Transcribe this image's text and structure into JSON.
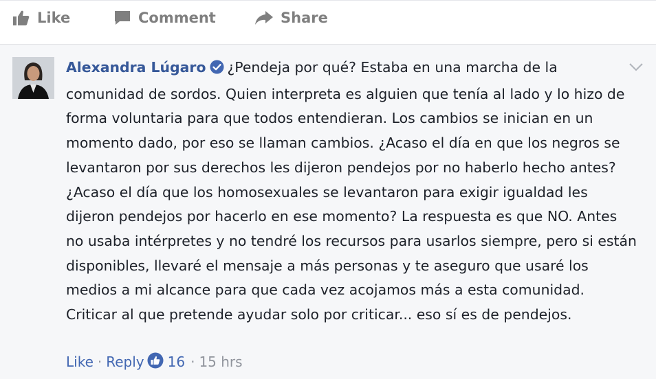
{
  "actions": {
    "like_label": "Like",
    "comment_label": "Comment",
    "share_label": "Share"
  },
  "comment": {
    "author": "Alexandra Lúgaro",
    "text": "¿Pendeja por qué? Estaba en una marcha de la comunidad de sordos. Quien interpreta es alguien que tenía al lado y lo hizo de forma voluntaria para que todos entendieran. Los cambios se inician en un momento dado, por eso se llaman cambios. ¿Acaso el día en que los negros se levantaron por sus derechos les dijeron pendejos por no haberlo hecho antes? ¿Acaso el día que los homosexuales se levantaron para exigir igualdad les dijeron pendejos por hacerlo en ese momento? La respuesta es que NO. Antes no usaba intérpretes y no tendré los recursos para usarlos siempre, pero si están disponibles, llevaré el mensaje a más personas y te aseguro que usaré los medios a mi alcance para que cada vez acojamos más a esta comunidad. Criticar al que pretende ayudar solo por criticar... eso sí es de pendejos.",
    "like_label": "Like",
    "reply_label": "Reply",
    "separator": "·",
    "reaction_count": "16",
    "timestamp": "15 hrs"
  },
  "icons": {
    "like": "thumbs-up-icon",
    "comment": "speech-bubble-icon",
    "share": "share-arrow-icon",
    "verified": "verified-badge-icon",
    "menu": "chevron-down-icon",
    "reaction": "like-reaction-icon"
  },
  "colors": {
    "author": "#365899",
    "link": "#4267b2",
    "verified": "#4267b2",
    "action_gray": "#7f7f7f",
    "meta_gray": "#90949c",
    "comment_bg": "#f6f7f9"
  }
}
